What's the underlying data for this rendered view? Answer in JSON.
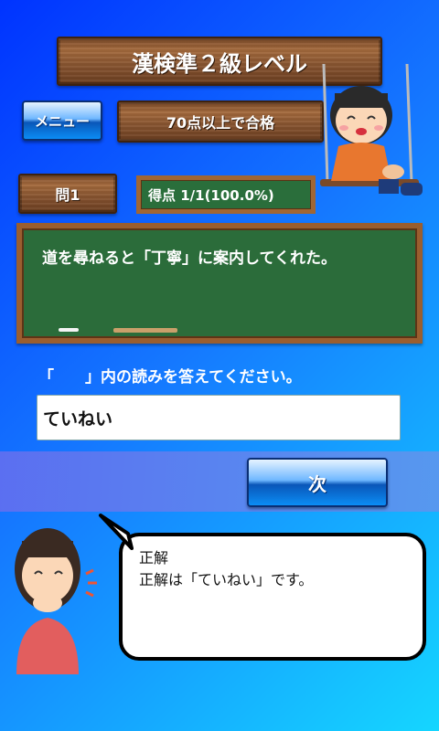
{
  "header": {
    "title": "漢検準２級レベル"
  },
  "menu_button": {
    "label": "メニュー"
  },
  "pass_banner": {
    "label": "70点以上で合格"
  },
  "question_number": {
    "label": "問1"
  },
  "score": {
    "label": "得点 1/1(100.0%)"
  },
  "question": {
    "text": "道を尋ねると「丁寧」に案内してくれた。"
  },
  "instruction": {
    "text": "「　　」内の読みを答えてください。"
  },
  "answer_input": {
    "value": "ていねい"
  },
  "next_button": {
    "label": "次"
  },
  "feedback": {
    "title": "正解",
    "message": "正解は「ていねい」です。"
  },
  "colors": {
    "board_green": "#2b6c3a",
    "wood_brown": "#8a5631",
    "button_blue": "#0b8df5"
  }
}
